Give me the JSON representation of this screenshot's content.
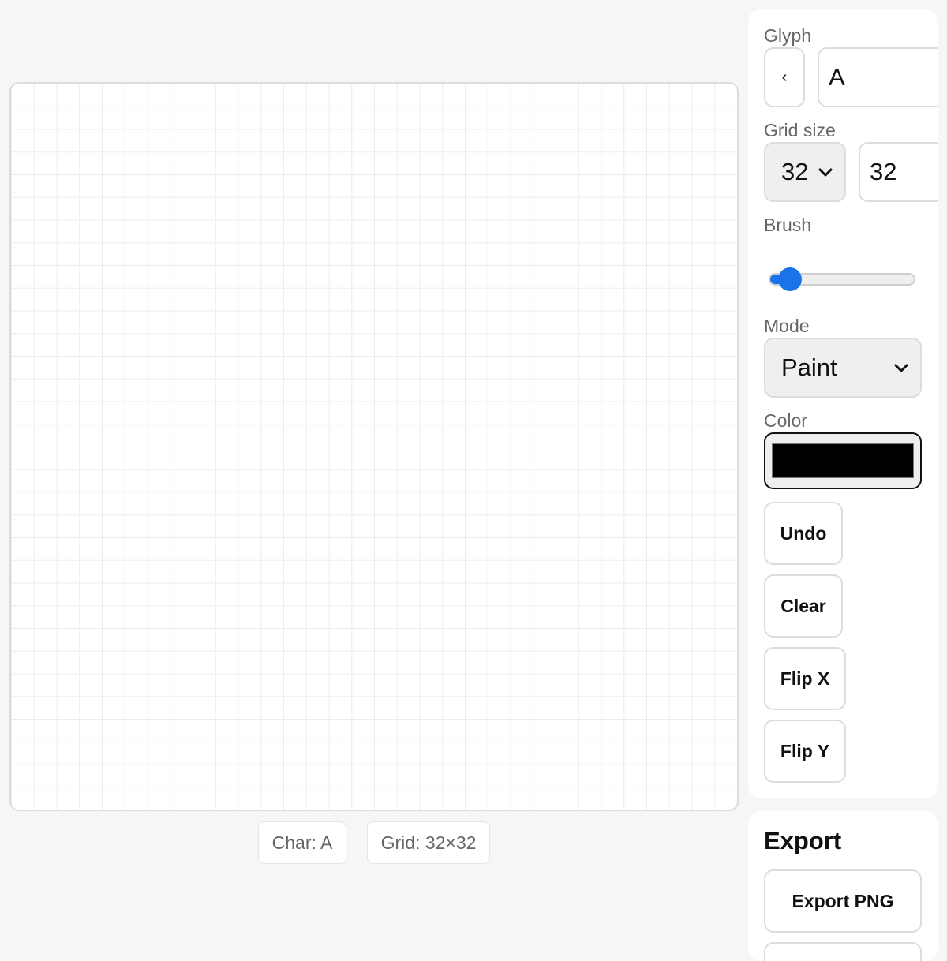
{
  "canvas": {
    "grid_size": 32
  },
  "status": {
    "char": "Char: A",
    "grid": "Grid: 32×32"
  },
  "panel": {
    "glyph_label": "Glyph",
    "prev_label": "‹",
    "glyph_value": "A",
    "grid_size_label": "Grid size",
    "grid_size_select": "32",
    "grid_size_input": "32",
    "brush_label": "Brush",
    "brush_value_fraction": 0.14,
    "mode_label": "Mode",
    "mode_value": "Paint",
    "color_label": "Color",
    "color_value": "#000000",
    "undo_label": "Undo",
    "clear_label": "Clear",
    "flipx_label": "Flip X",
    "flipy_label": "Flip Y"
  },
  "export": {
    "title": "Export",
    "export_png_label": "Export PNG"
  },
  "colors": {
    "accent": "#1a73e8",
    "background": "#f6f6f6",
    "panel": "#ffffff"
  }
}
